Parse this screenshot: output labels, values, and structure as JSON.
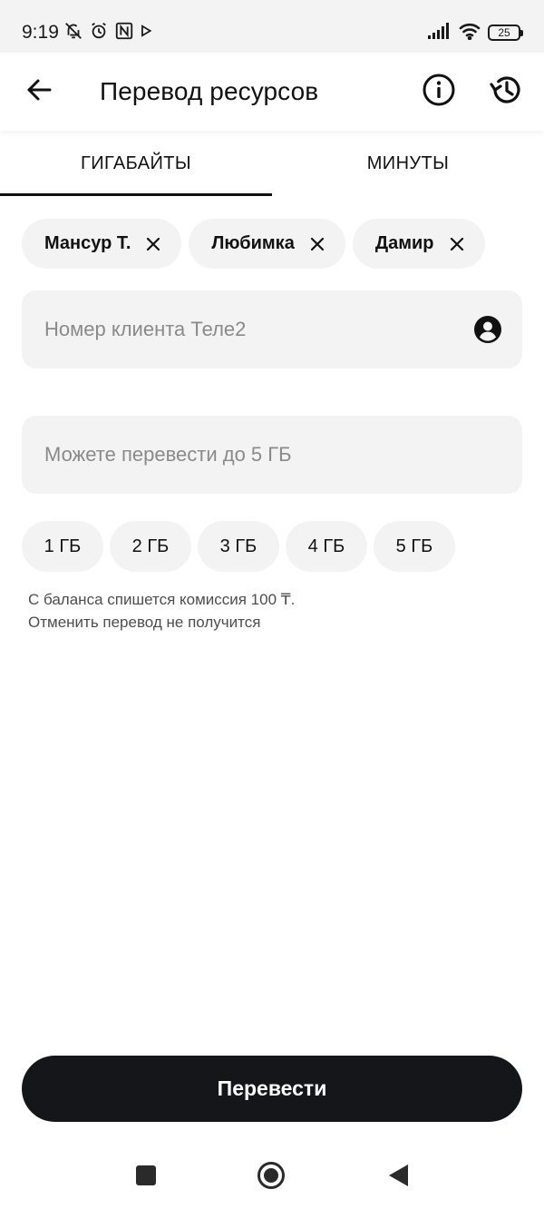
{
  "status_bar": {
    "time": "9:19",
    "battery": "25",
    "left_icons": [
      "muted-bell-icon",
      "alarm-icon",
      "nfc-icon",
      "play-store-icon"
    ],
    "right_icons": [
      "signal-icon",
      "wifi-icon",
      "battery-icon"
    ]
  },
  "app_bar": {
    "title": "Перевод ресурсов",
    "icons": [
      "back-arrow-icon",
      "info-icon",
      "history-icon"
    ]
  },
  "tabs": [
    {
      "label": "ГИГАБАЙТЫ",
      "active": true
    },
    {
      "label": "МИНУТЫ",
      "active": false
    }
  ],
  "contact_chips": [
    {
      "label": "Мансур Т."
    },
    {
      "label": "Любимка"
    },
    {
      "label": "Дамир"
    }
  ],
  "phone_input": {
    "placeholder": "Номер клиента Теле2",
    "value": ""
  },
  "amount_input": {
    "placeholder": "Можете перевести до 5 ГБ",
    "value": ""
  },
  "amount_options": [
    "1 ГБ",
    "2 ГБ",
    "3 ГБ",
    "4 ГБ",
    "5 ГБ"
  ],
  "notice": {
    "line1": "С баланса спишется комиссия 100 ₸.",
    "line2": "Отменить перевод не получится"
  },
  "submit_label": "Перевести",
  "colors": {
    "primary_button": "#14161a",
    "surface": "#f3f3f3",
    "placeholder": "#8a8a8a",
    "text": "#111111"
  }
}
